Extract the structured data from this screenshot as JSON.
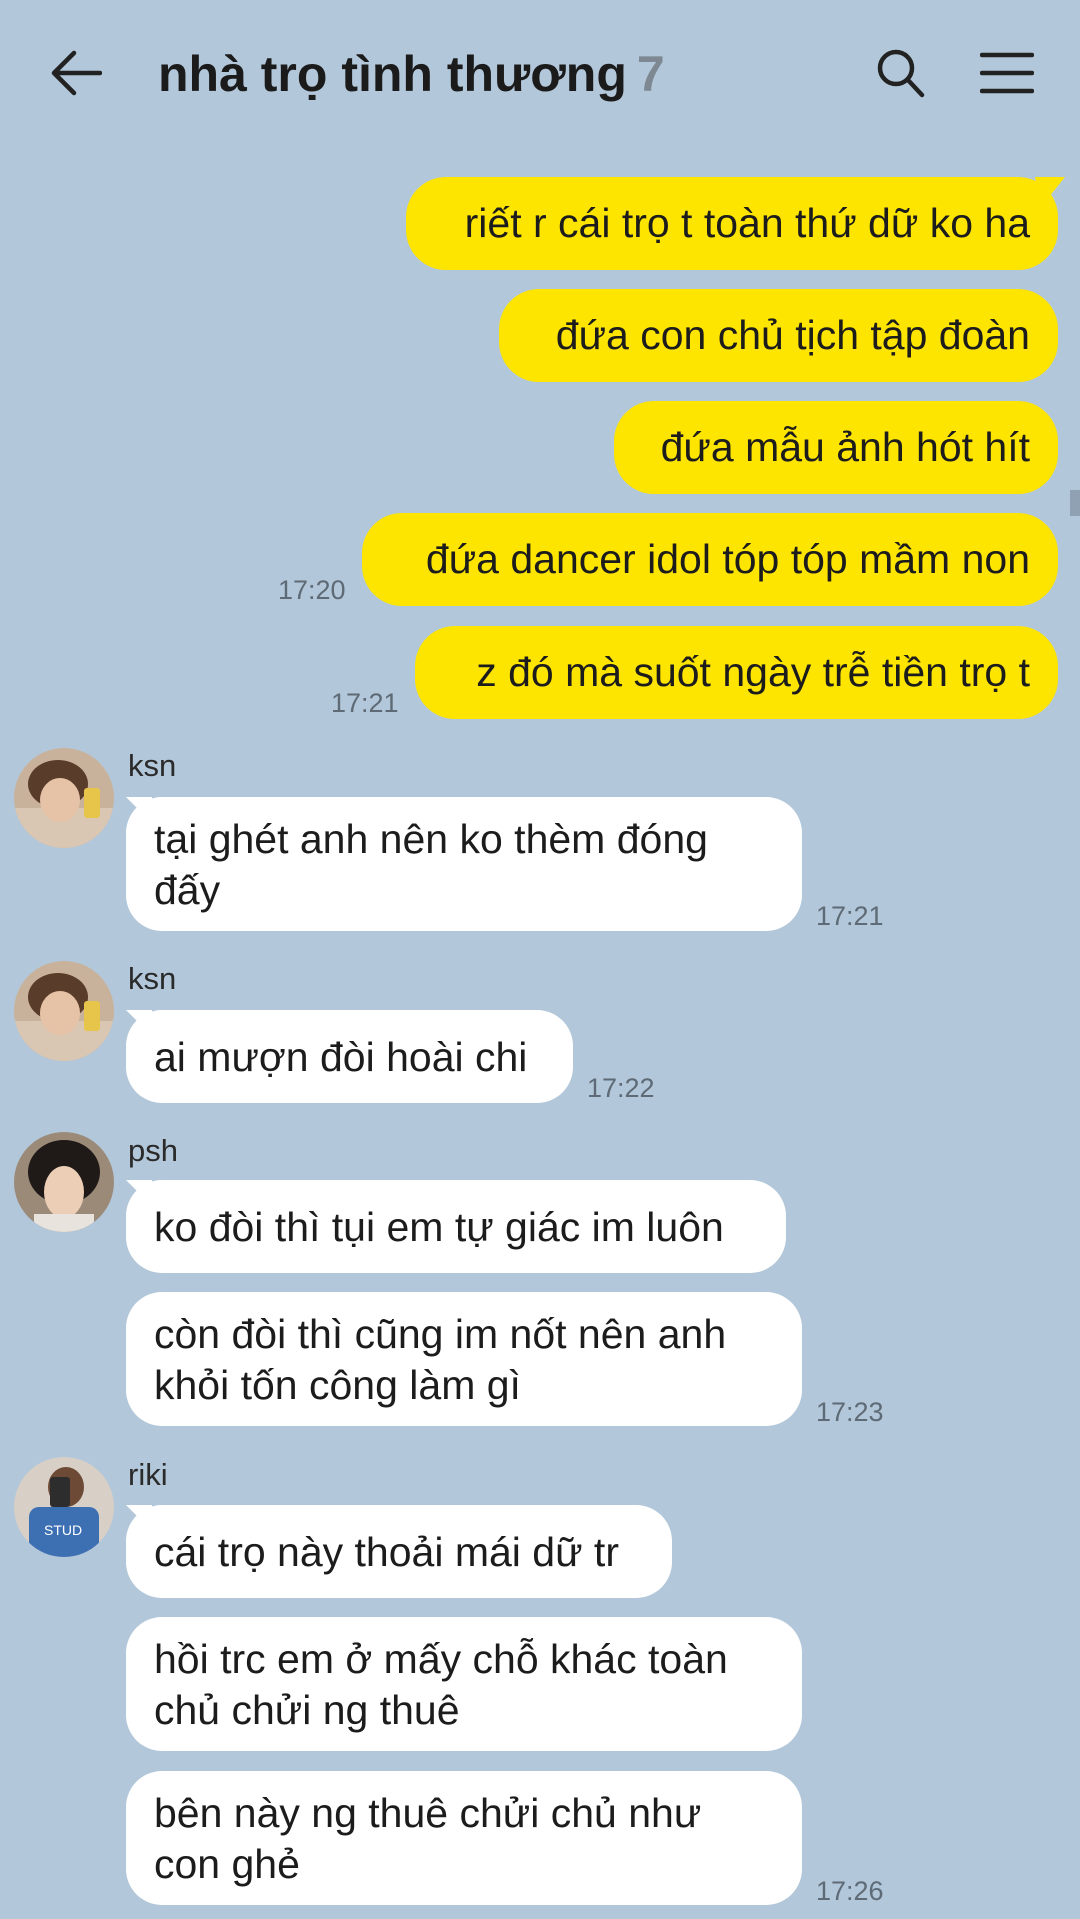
{
  "header": {
    "title": "nhà trọ tình thương",
    "member_count": "7",
    "back_icon": "arrow-left-icon",
    "search_icon": "search-icon",
    "menu_icon": "hamburger-menu-icon"
  },
  "colors": {
    "background": "#b2c7d9",
    "outgoing_bubble": "#fee500",
    "incoming_bubble": "#ffffff"
  },
  "outgoing": [
    {
      "text": "riết r cái trọ t toàn thứ dữ ko ha"
    },
    {
      "text": "đứa con chủ tịch tập đoàn"
    },
    {
      "text": "đứa mẫu ảnh hót hít"
    },
    {
      "text": "đứa dancer idol tóp tóp mầm non",
      "time": "17:20"
    },
    {
      "text": "z đó mà suốt ngày trễ tiền trọ t",
      "time": "17:21"
    }
  ],
  "incoming": [
    {
      "sender": "ksn",
      "messages": [
        {
          "text": "tại ghét anh nên ko thèm đóng đấy",
          "time": "17:21"
        }
      ]
    },
    {
      "sender": "ksn",
      "messages": [
        {
          "text": "ai mượn đòi hoài chi",
          "time": "17:22"
        }
      ]
    },
    {
      "sender": "psh",
      "messages": [
        {
          "text": "ko đòi thì tụi em tự giác im luôn"
        },
        {
          "text": "còn đòi thì cũng im nốt nên anh khỏi tốn công làm gì",
          "time": "17:23"
        }
      ]
    },
    {
      "sender": "riki",
      "messages": [
        {
          "text": "cái trọ này thoải mái dữ tr"
        },
        {
          "text": "hồi trc em ở mấy chỗ khác toàn chủ chửi ng thuê"
        },
        {
          "text": "bên này ng thuê chửi chủ như con ghẻ",
          "time": "17:26"
        }
      ]
    }
  ]
}
